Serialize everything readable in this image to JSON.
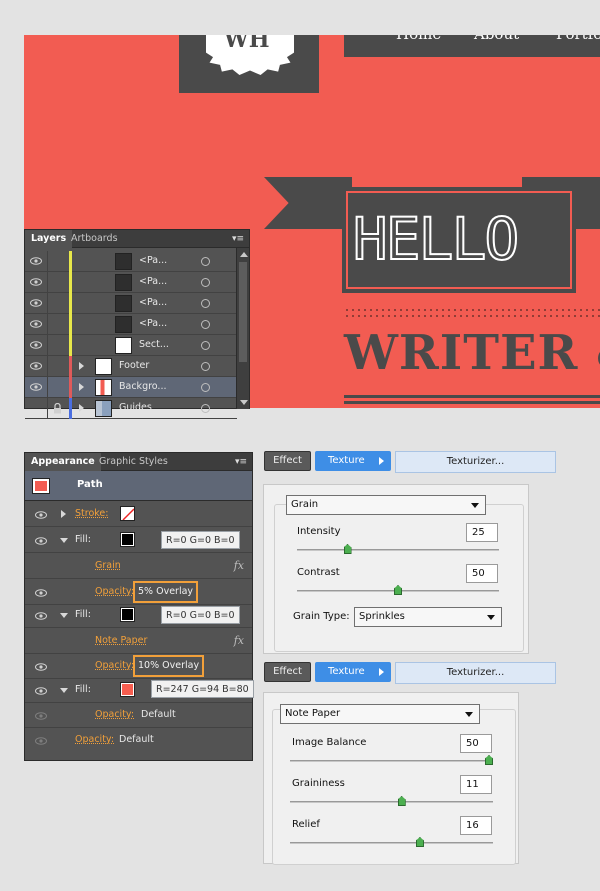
{
  "artwork": {
    "logo_text": "WH",
    "nav": [
      "Home",
      "About",
      "Portfo"
    ],
    "hello": "HELLO",
    "headline": "WRITER &"
  },
  "layers_panel": {
    "tabs": [
      "Layers",
      "Artboards"
    ],
    "rows": [
      {
        "name": "<Pa...",
        "bar_color": "#e8e84a",
        "thumb": "dark",
        "indent": "sub"
      },
      {
        "name": "<Pa...",
        "bar_color": "#e8e84a",
        "thumb": "dark",
        "indent": "sub"
      },
      {
        "name": "<Pa...",
        "bar_color": "#e8e84a",
        "thumb": "dark",
        "indent": "sub"
      },
      {
        "name": "<Pa...",
        "bar_color": "#e8e84a",
        "thumb": "dark",
        "indent": "sub"
      },
      {
        "name": "Sect...",
        "bar_color": "#e8e84a",
        "thumb": "white",
        "indent": "sub"
      },
      {
        "name": "Footer",
        "bar_color": "#e05a5a",
        "thumb": "footer",
        "indent": "top"
      },
      {
        "name": "Backgro...",
        "bar_color": "#e05a5a",
        "thumb": "background",
        "indent": "top",
        "selected": true
      },
      {
        "name": "Guides",
        "bar_color": "#4a6ee0",
        "thumb": "guides",
        "indent": "top",
        "locked": true
      }
    ]
  },
  "appearance_panel": {
    "tabs": [
      "Appearance",
      "Graphic Styles"
    ],
    "header_title": "Path",
    "stroke_label": "Stroke:",
    "fill_label": "Fill:",
    "grain_effect": "Grain",
    "opacity_label": "Opacity:",
    "opacity_1": "5% Overlay",
    "fill_1_callout": "R=0 G=0 B=0",
    "fill_2_callout": "R=0 G=0 B=0",
    "note_paper_effect": "Note Paper",
    "opacity_2": "10% Overlay",
    "fill_3_callout": "R=247 G=94 B=80",
    "opacity_3": "Default",
    "opacity_4": "Default",
    "fx_icon": "fx",
    "colors": {
      "fill_1": "#000000",
      "fill_2": "#000000",
      "fill_3": "#f75e50"
    }
  },
  "breadcrumb_1": {
    "effect": "Effect",
    "texture": "Texture",
    "filter": "Texturizer..."
  },
  "breadcrumb_2": {
    "effect": "Effect",
    "texture": "Texture",
    "filter": "Texturizer..."
  },
  "grain_dialog": {
    "type_select": "Grain",
    "intensity_label": "Intensity",
    "intensity_value": "25",
    "intensity_fraction": 0.25,
    "contrast_label": "Contrast",
    "contrast_value": "50",
    "contrast_fraction": 0.5,
    "grain_type_label": "Grain Type:",
    "grain_type_value": "Sprinkles"
  },
  "note_paper_dialog": {
    "type_select": "Note Paper",
    "balance_label": "Image Balance",
    "balance_value": "50",
    "balance_fraction": 1.0,
    "graininess_label": "Graininess",
    "graininess_value": "11",
    "graininess_fraction": 0.55,
    "relief_label": "Relief",
    "relief_value": "16",
    "relief_fraction": 0.64
  }
}
